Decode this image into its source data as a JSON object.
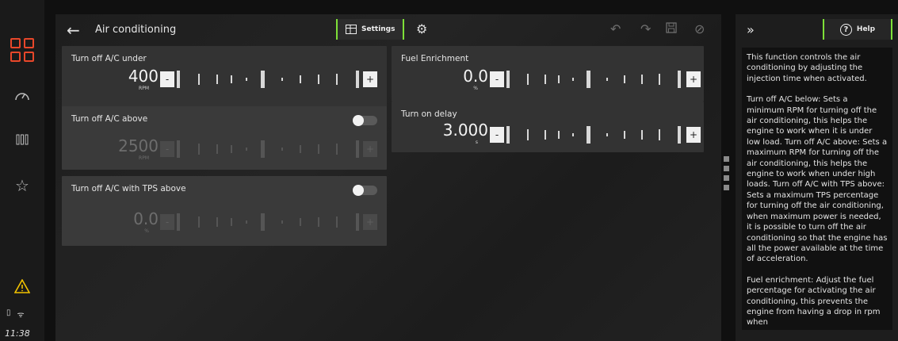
{
  "window": {
    "title": "Air conditioning"
  },
  "toolbar": {
    "settings_label": "Settings"
  },
  "status": {
    "time": "11:38"
  },
  "cards": [
    {
      "label": "Turn off A/C under",
      "value": "400",
      "unit": "RPM",
      "minus": "-",
      "plus": "+"
    },
    {
      "label": "Turn off A/C above",
      "value": "2500",
      "unit": "RPM",
      "minus": "-",
      "plus": "+"
    },
    {
      "label": "Turn off A/C with TPS above",
      "value": "0.0",
      "unit": "%",
      "minus": "-",
      "plus": "+"
    },
    {
      "label": "Fuel Enrichment",
      "value": "0.0",
      "unit": "%",
      "minus": "-",
      "plus": "+"
    },
    {
      "label": "Turn on delay",
      "value": "3.000",
      "unit": "s",
      "minus": "-",
      "plus": "+"
    }
  ],
  "help": {
    "button_label": "Help",
    "paragraphs": [
      "This function controls the air conditioning by adjusting the injection time when activated.",
      "Turn off A/C below: Sets a minimum RPM for turning off the air conditioning, this helps the engine to work when it is under low load. Turn off A/C above: Sets a maximum RPM for turning off the air conditioning, this helps the engine to work when under high loads. Turn off A/C with TPS above: Sets a maximum TPS percentage for turning off the air conditioning, when maximum power is needed, it is possible to turn off the air conditioning so that the engine has all the power available at the time of acceleration.",
      "Fuel enrichment: Adjust the fuel percentage for activating the air conditioning, this prevents the engine from having a drop in rpm when"
    ]
  },
  "colors": {
    "accent": "#7ee038",
    "brand": "#e8472a",
    "warning": "#f2c200"
  },
  "icons": [
    "apps-grid-icon",
    "gauge-icon",
    "bars-icon",
    "star-icon",
    "warning-icon",
    "battery-icon",
    "wifi-icon",
    "back-arrow-icon",
    "table-icon",
    "gear-icon",
    "undo-icon",
    "redo-icon",
    "save-icon",
    "cancel-icon",
    "collapse-icon",
    "help-icon"
  ]
}
